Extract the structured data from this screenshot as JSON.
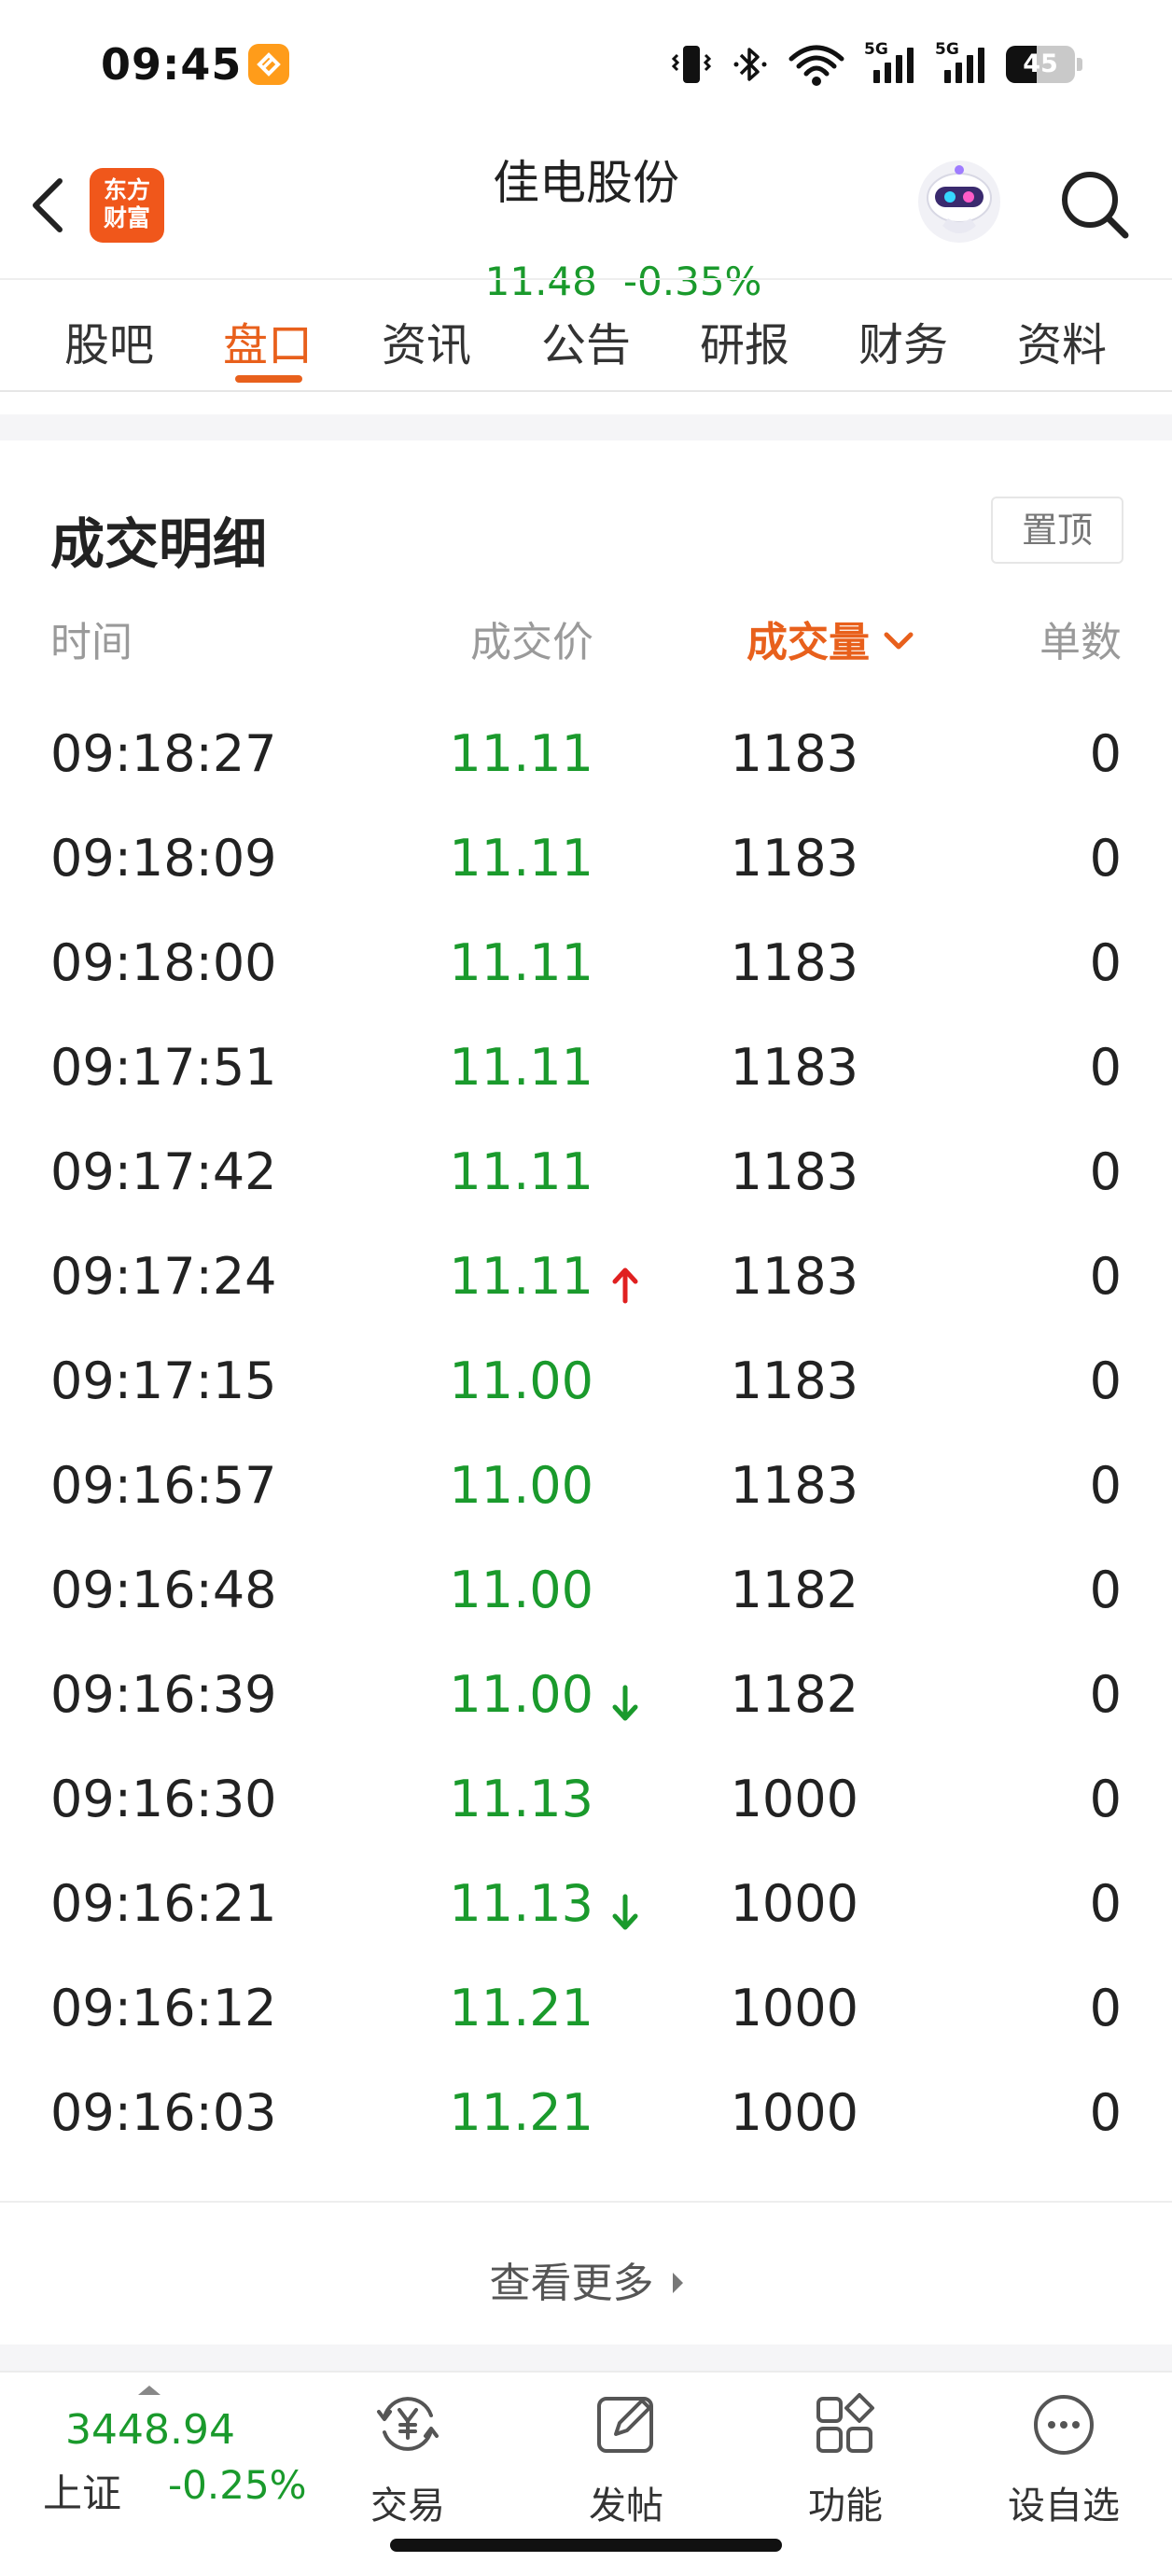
{
  "status_bar": {
    "time": "09:45",
    "signal_label_1": "5G",
    "signal_label_2": "5G",
    "battery_level": "45",
    "icons": [
      "app-notification-icon",
      "vibrate-icon",
      "bluetooth-icon",
      "wifi-icon",
      "cell-signal-icon",
      "cell-signal-icon",
      "battery-icon"
    ]
  },
  "header": {
    "logo_line1": "东方",
    "logo_line2": "财富",
    "stock_name": "佳电股份",
    "price": "11.48",
    "change_pct": "-0.35%",
    "price_color": "#1a9a2c"
  },
  "tabs": [
    {
      "label": "股吧",
      "active": false
    },
    {
      "label": "盘口",
      "active": true
    },
    {
      "label": "资讯",
      "active": false
    },
    {
      "label": "公告",
      "active": false
    },
    {
      "label": "研报",
      "active": false
    },
    {
      "label": "财务",
      "active": false
    },
    {
      "label": "资料",
      "active": false
    }
  ],
  "trades": {
    "title": "成交明细",
    "pin_label": "置顶",
    "columns": {
      "time": "时间",
      "price": "成交价",
      "volume": "成交量",
      "count": "单数"
    },
    "sorted_by": "volume",
    "rows": [
      {
        "time": "09:18:27",
        "price": "11.11",
        "arrow": "",
        "volume": "1183",
        "count": "0"
      },
      {
        "time": "09:18:09",
        "price": "11.11",
        "arrow": "",
        "volume": "1183",
        "count": "0"
      },
      {
        "time": "09:18:00",
        "price": "11.11",
        "arrow": "",
        "volume": "1183",
        "count": "0"
      },
      {
        "time": "09:17:51",
        "price": "11.11",
        "arrow": "",
        "volume": "1183",
        "count": "0"
      },
      {
        "time": "09:17:42",
        "price": "11.11",
        "arrow": "",
        "volume": "1183",
        "count": "0"
      },
      {
        "time": "09:17:24",
        "price": "11.11",
        "arrow": "up",
        "volume": "1183",
        "count": "0"
      },
      {
        "time": "09:17:15",
        "price": "11.00",
        "arrow": "",
        "volume": "1183",
        "count": "0"
      },
      {
        "time": "09:16:57",
        "price": "11.00",
        "arrow": "",
        "volume": "1183",
        "count": "0"
      },
      {
        "time": "09:16:48",
        "price": "11.00",
        "arrow": "",
        "volume": "1182",
        "count": "0"
      },
      {
        "time": "09:16:39",
        "price": "11.00",
        "arrow": "down",
        "volume": "1182",
        "count": "0"
      },
      {
        "time": "09:16:30",
        "price": "11.13",
        "arrow": "",
        "volume": "1000",
        "count": "0"
      },
      {
        "time": "09:16:21",
        "price": "11.13",
        "arrow": "down",
        "volume": "1000",
        "count": "0"
      },
      {
        "time": "09:16:12",
        "price": "11.21",
        "arrow": "",
        "volume": "1000",
        "count": "0"
      },
      {
        "time": "09:16:03",
        "price": "11.21",
        "arrow": "",
        "volume": "1000",
        "count": "0"
      }
    ],
    "more_label": "查看更多",
    "colors": {
      "price": "#1a9a2c",
      "arrow_up": "#e02020",
      "arrow_down": "#1a9a2c",
      "accent": "#e8601c"
    }
  },
  "bottom_bar": {
    "index_value": "3448.94",
    "index_name": "上证",
    "index_change": "-0.25%",
    "nav": [
      {
        "label": "交易",
        "icon": "yen-exchange-icon"
      },
      {
        "label": "发帖",
        "icon": "edit-post-icon"
      },
      {
        "label": "功能",
        "icon": "grid-function-icon"
      },
      {
        "label": "设自选",
        "icon": "more-dots-icon"
      }
    ]
  }
}
